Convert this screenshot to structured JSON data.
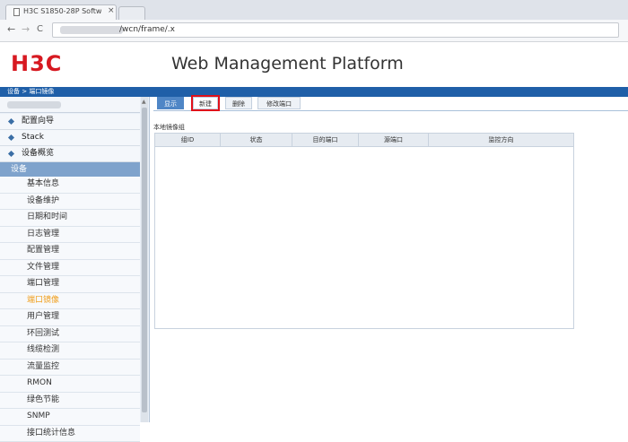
{
  "browser": {
    "tab_title": "H3C S1850-28P Softw",
    "tab_close": "×",
    "back": "←",
    "forward": "→",
    "reload": "C",
    "url": "/wcn/frame/.x"
  },
  "header": {
    "logo": "H3C",
    "title": "Web Management Platform",
    "breadcrumb": "设备 > 端口镜像"
  },
  "sidebar": {
    "top_items": [
      {
        "label": "配置向导"
      },
      {
        "label": "Stack"
      },
      {
        "label": "设备概览"
      }
    ],
    "group": "设备",
    "items": [
      {
        "label": "基本信息"
      },
      {
        "label": "设备维护"
      },
      {
        "label": "日期和时间"
      },
      {
        "label": "日志管理"
      },
      {
        "label": "配置管理"
      },
      {
        "label": "文件管理"
      },
      {
        "label": "端口管理"
      },
      {
        "label": "端口镜像",
        "active": true
      },
      {
        "label": "用户管理"
      },
      {
        "label": "环回测试"
      },
      {
        "label": "线缆检测"
      },
      {
        "label": "流量监控"
      },
      {
        "label": "RMON"
      },
      {
        "label": "绿色节能"
      },
      {
        "label": "SNMP"
      },
      {
        "label": "接口统计信息"
      }
    ]
  },
  "main": {
    "tabs": [
      {
        "label": "显示"
      },
      {
        "label": "新建"
      },
      {
        "label": "删除"
      },
      {
        "label": "修改端口"
      }
    ],
    "section_label": "本地镜像组",
    "columns": [
      "组ID",
      "状态",
      "目的端口",
      "源端口",
      "监控方向"
    ]
  }
}
